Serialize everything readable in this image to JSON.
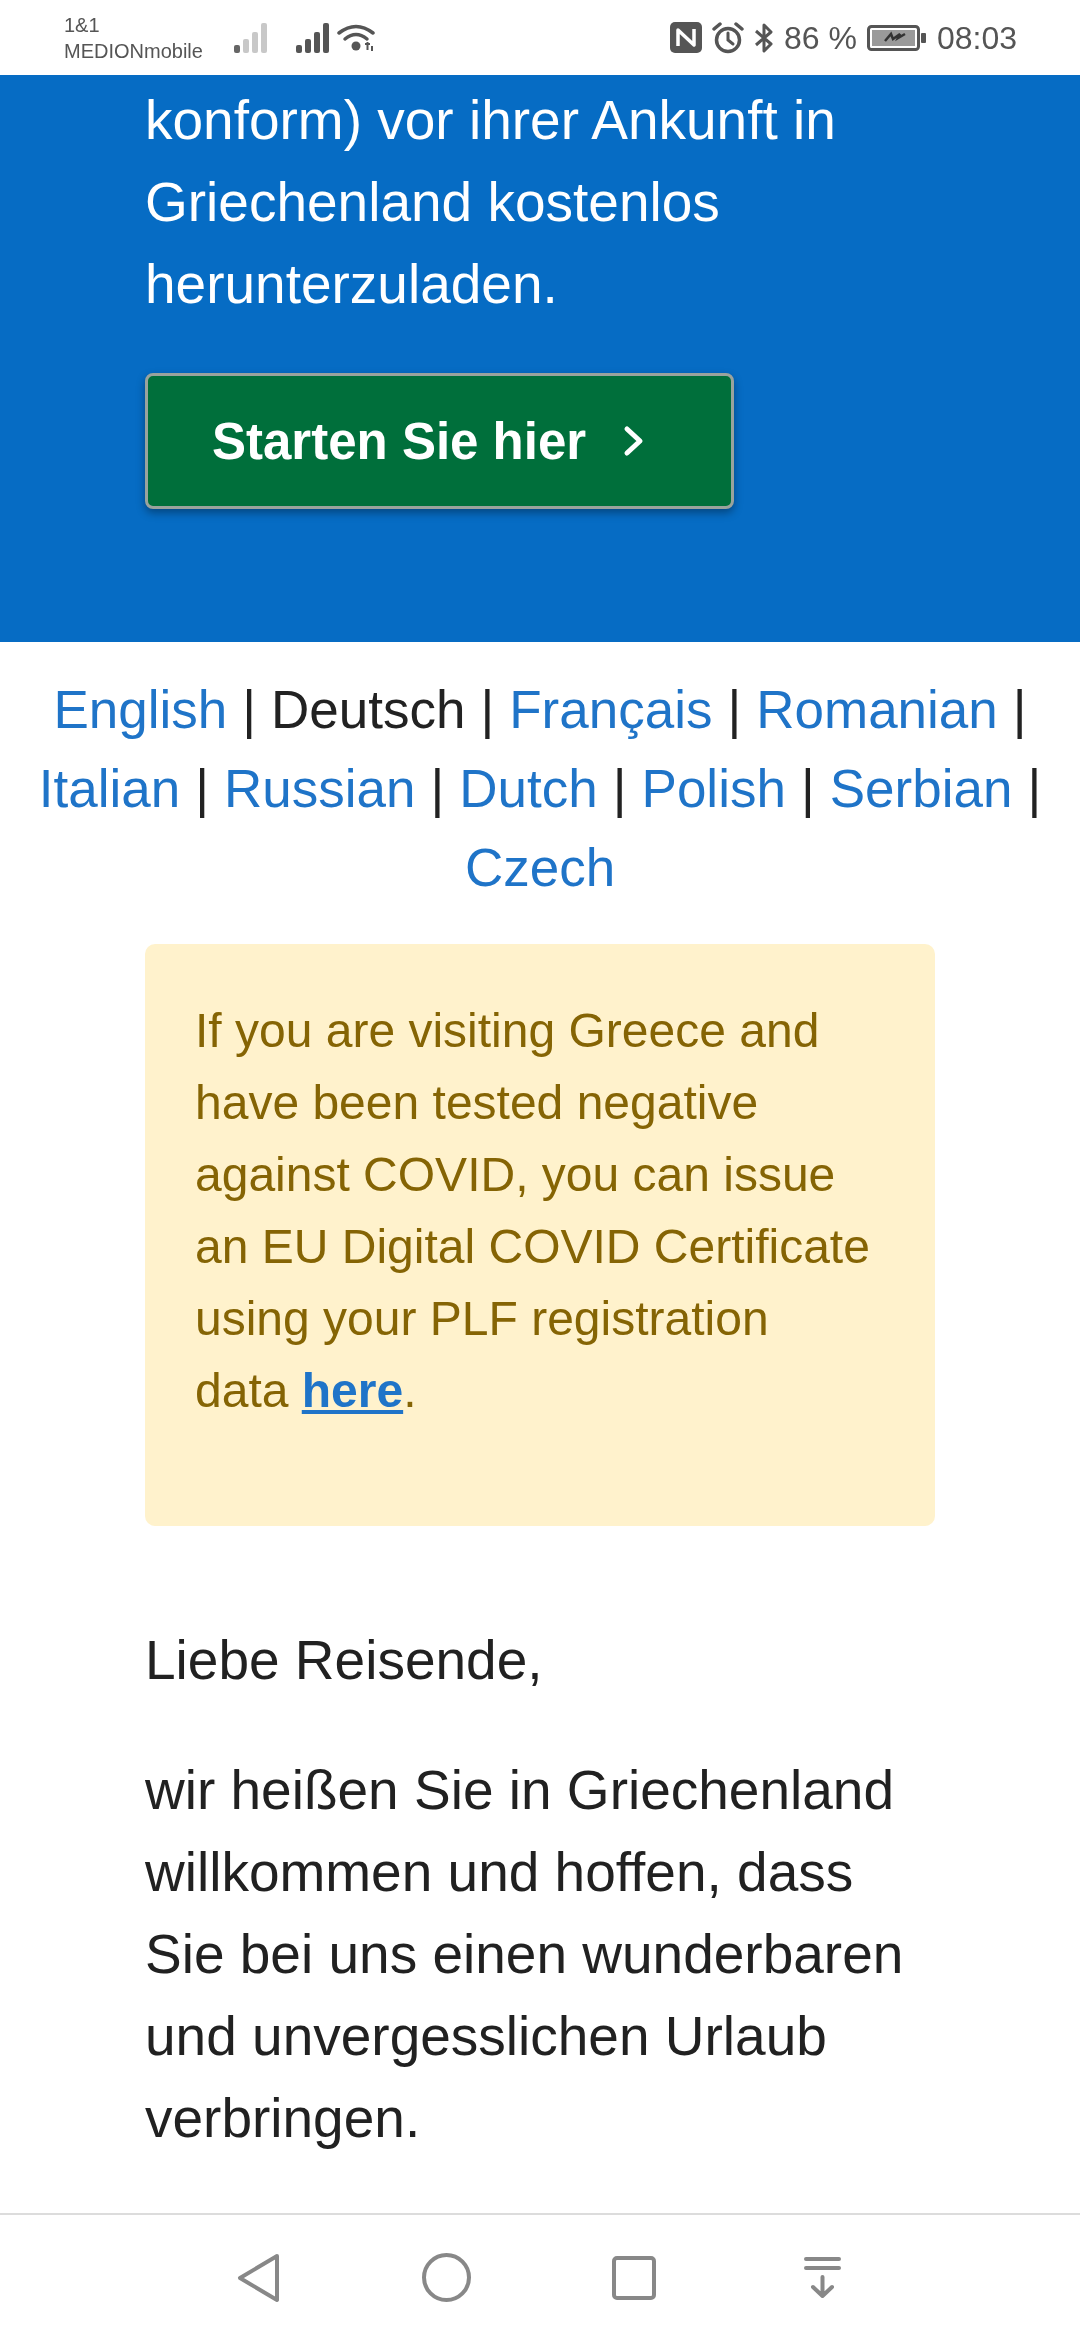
{
  "status_bar": {
    "carrier": [
      "1&1",
      "MEDIONmobile"
    ],
    "battery": "86 %",
    "time": "08:03"
  },
  "hero": {
    "text": "konform) vor ihrer Ankunft in Griechenland kostenlos herunterzuladen.",
    "button": {
      "label": "Starten Sie hier"
    }
  },
  "languages": {
    "separator": "|",
    "items": [
      {
        "label": "English",
        "selected": false
      },
      {
        "label": "Deutsch",
        "selected": true
      },
      {
        "label": "Français",
        "selected": false
      },
      {
        "label": "Romanian",
        "selected": false
      },
      {
        "label": "Italian",
        "selected": false
      },
      {
        "label": "Russian",
        "selected": false
      },
      {
        "label": "Dutch",
        "selected": false
      },
      {
        "label": "Polish",
        "selected": false
      },
      {
        "label": "Serbian",
        "selected": false
      },
      {
        "label": "Czech",
        "selected": false
      }
    ]
  },
  "notice": {
    "text": "If you are visiting Greece and have been tested negative against COVID, you can issue an EU Digital COVID Certificate using your PLF registration data ",
    "link": "here",
    "after_link": "."
  },
  "greeting": "Liebe Reisende,",
  "intro": "wir heißen Sie in Griechenland willkommen und hoffen, dass Sie bei uns einen wunderbaren und unvergesslichen Urlaub verbringen."
}
